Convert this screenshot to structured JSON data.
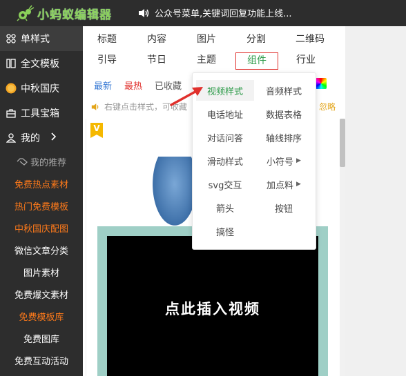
{
  "app": {
    "title": "小蚂蚁编辑器",
    "notice": "公众号菜单,关键词回复功能上线..."
  },
  "sidebar": {
    "items": [
      {
        "label": "单样式",
        "icon": "grid-icon"
      },
      {
        "label": "全文模板",
        "icon": "template-icon"
      },
      {
        "label": "中秋国庆",
        "icon": "moon-icon"
      },
      {
        "label": "工具宝箱",
        "icon": "toolbox-icon"
      },
      {
        "label": "我的",
        "icon": "user-icon"
      }
    ],
    "recommend_label": "我的推荐",
    "links": [
      {
        "label": "免费热点素材",
        "style": "orange"
      },
      {
        "label": "热门免费模板",
        "style": "orange"
      },
      {
        "label": "中秋国庆配图",
        "style": "orange"
      },
      {
        "label": "微信文章分类",
        "style": "white"
      },
      {
        "label": "图片素材",
        "style": "white"
      },
      {
        "label": "免费爆文素材",
        "style": "white"
      },
      {
        "label": "免费模板库",
        "style": "orange"
      },
      {
        "label": "免费图库",
        "style": "white"
      },
      {
        "label": "免费互动活动",
        "style": "white"
      }
    ]
  },
  "tabs": {
    "row1": [
      "标题",
      "内容",
      "图片",
      "分割",
      "二维码"
    ],
    "row2": [
      "引导",
      "节日",
      "主题",
      "组件",
      "行业"
    ],
    "selected": "组件"
  },
  "subtabs": {
    "newest": "最新",
    "hottest": "最热",
    "favorited": "已收藏"
  },
  "hint": {
    "text": "右键点击样式，可收藏",
    "ignore": "忽略"
  },
  "preview": {
    "badge": "V",
    "video_text": "点此插入视频"
  },
  "dropdown": {
    "items": [
      {
        "label": "视频样式",
        "highlight": true,
        "submenu": false
      },
      {
        "label": "音频样式",
        "highlight": false,
        "submenu": false
      },
      {
        "label": "电话地址",
        "highlight": false,
        "submenu": false
      },
      {
        "label": "数据表格",
        "highlight": false,
        "submenu": false
      },
      {
        "label": "对话问答",
        "highlight": false,
        "submenu": false
      },
      {
        "label": "轴线排序",
        "highlight": false,
        "submenu": false
      },
      {
        "label": "滑动样式",
        "highlight": false,
        "submenu": false
      },
      {
        "label": "小符号",
        "highlight": false,
        "submenu": true
      },
      {
        "label": "svg交互",
        "highlight": false,
        "submenu": false
      },
      {
        "label": "加点料",
        "highlight": false,
        "submenu": true
      },
      {
        "label": "箭头",
        "highlight": false,
        "submenu": false
      },
      {
        "label": "按钮",
        "highlight": false,
        "submenu": false
      },
      {
        "label": "搞怪",
        "highlight": false,
        "submenu": false
      }
    ]
  },
  "colors": {
    "brand_green": "#8bd05a",
    "selected_green": "#2e9b4a",
    "accent_red": "#e0302c",
    "sidebar_bg": "#2d2d2d",
    "orange": "#ff7a1a"
  }
}
